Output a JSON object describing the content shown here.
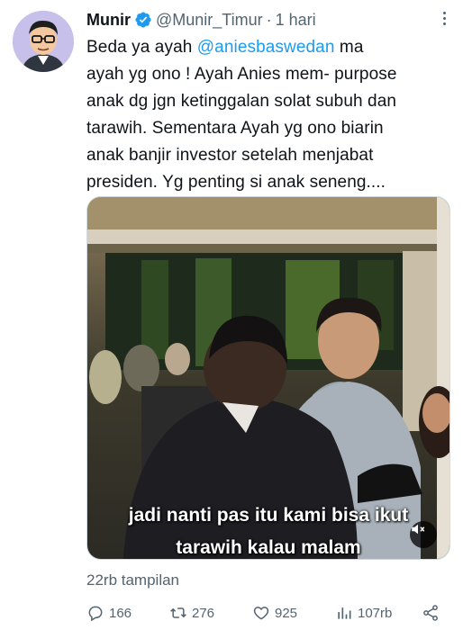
{
  "author": {
    "name": "Munir",
    "handle": "@Munir_Timur",
    "separator": "·",
    "time": "1 hari"
  },
  "tweet": {
    "lines": [
      {
        "before": "Beda ya ayah ",
        "mention": "@aniesbaswedan",
        "after": " ma"
      },
      {
        "text": "ayah yg ono ! Ayah Anies mem- purpose"
      },
      {
        "text": "anak dg jgn ketinggalan solat subuh dan"
      },
      {
        "text": "tarawih. Sementara Ayah yg ono biarin"
      },
      {
        "text": "anak banjir investor setelah menjabat"
      },
      {
        "text": "presiden. Yg penting si anak seneng...."
      }
    ]
  },
  "media": {
    "subtitle_line1": "jadi nanti pas itu kami bisa ikut",
    "subtitle_line2": "tarawih kalau malam",
    "mute_icon": "speaker-muted-icon"
  },
  "views_text": "22rb tampilan",
  "actions": {
    "reply_count": "166",
    "retweet_count": "276",
    "like_count": "925",
    "views_count": "107rb"
  },
  "colors": {
    "accent": "#1d9bf0",
    "text": "#0f1419",
    "muted": "#536471"
  },
  "icons": [
    "verified-badge-icon",
    "more-icon",
    "reply-icon",
    "retweet-icon",
    "like-icon",
    "views-icon",
    "share-icon"
  ]
}
